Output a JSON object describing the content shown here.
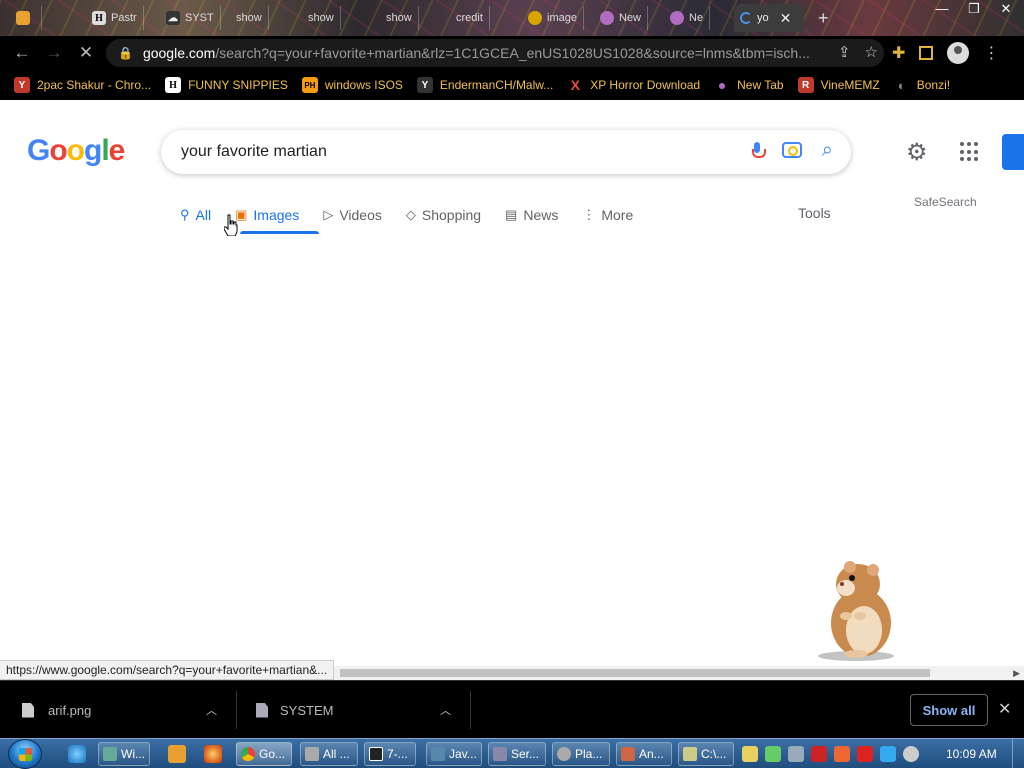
{
  "browser": {
    "tabs": [
      {
        "label": "",
        "favicon": "flame-icon"
      },
      {
        "label": "Pastr",
        "favicon": "H"
      },
      {
        "label": "SYST",
        "favicon": "cloud-icon"
      },
      {
        "label": "show",
        "favicon": ""
      },
      {
        "label": "show",
        "favicon": ""
      },
      {
        "label": "show",
        "favicon": ""
      },
      {
        "label": "credit",
        "favicon": ""
      },
      {
        "label": "image",
        "favicon": ""
      },
      {
        "label": "New",
        "favicon": ""
      },
      {
        "label": "Ne",
        "favicon": ""
      },
      {
        "label": "yo",
        "favicon": "spinner-icon",
        "active": true
      }
    ],
    "new_tab": "+",
    "url_domain": "google.com",
    "url_rest": "/search?q=your+favorite+martian&rlz=1C1GCEA_enUS1028US1028&source=lnms&tbm=isch...",
    "bookmarks": [
      {
        "label": "2pac Shakur - Chro...",
        "icon": "Y",
        "color": "#c0392b"
      },
      {
        "label": "FUNNY SNIPPIES",
        "icon": "H",
        "color": "#fff"
      },
      {
        "label": "windows ISOS",
        "icon": "PH",
        "color": "#f39c12"
      },
      {
        "label": "EndermanCH/Malw...",
        "icon": "Y",
        "color": "#111"
      },
      {
        "label": "XP Horror Download",
        "icon": "X",
        "color": "#e74c3c"
      },
      {
        "label": "New Tab",
        "icon": "●",
        "color": "#a4a"
      },
      {
        "label": "VineMEMZ",
        "icon": "R",
        "color": "#c0392b"
      },
      {
        "label": "Bonzi!",
        "icon": "◐",
        "color": "#888"
      }
    ]
  },
  "google": {
    "logo": [
      "G",
      "o",
      "o",
      "g",
      "l",
      "e"
    ],
    "logo_colors": [
      "#4285f4",
      "#ea4335",
      "#fbbc05",
      "#4285f4",
      "#34a853",
      "#ea4335"
    ],
    "query": "your favorite martian",
    "tabs": [
      {
        "label": "All",
        "icon": "🔍"
      },
      {
        "label": "Images",
        "icon": "▣"
      },
      {
        "label": "Videos",
        "icon": "▷"
      },
      {
        "label": "Shopping",
        "icon": "◇"
      },
      {
        "label": "News",
        "icon": "▤"
      },
      {
        "label": "More",
        "icon": "⋮"
      }
    ],
    "tools": "Tools",
    "safesearch": "SafeSearch",
    "hover_url": "https://www.google.com/search?q=your+favorite+martian&..."
  },
  "downloads": {
    "items": [
      {
        "name": "arif.png"
      },
      {
        "name": "SYSTEM"
      }
    ],
    "show_all": "Show all"
  },
  "taskbar": {
    "buttons": [
      {
        "label": "Wi...",
        "color": "#6a9"
      },
      {
        "label": "Go...",
        "color": "#e44"
      },
      {
        "label": "All ...",
        "color": "#aaa"
      },
      {
        "label": "7-...",
        "color": "#222"
      },
      {
        "label": "Jav...",
        "color": "#58a"
      },
      {
        "label": "Ser...",
        "color": "#88a"
      },
      {
        "label": "Pla...",
        "color": "#aaa"
      },
      {
        "label": "An...",
        "color": "#c64"
      },
      {
        "label": "C:\\...",
        "color": "#cc8"
      }
    ],
    "clock": "10:09 AM"
  }
}
